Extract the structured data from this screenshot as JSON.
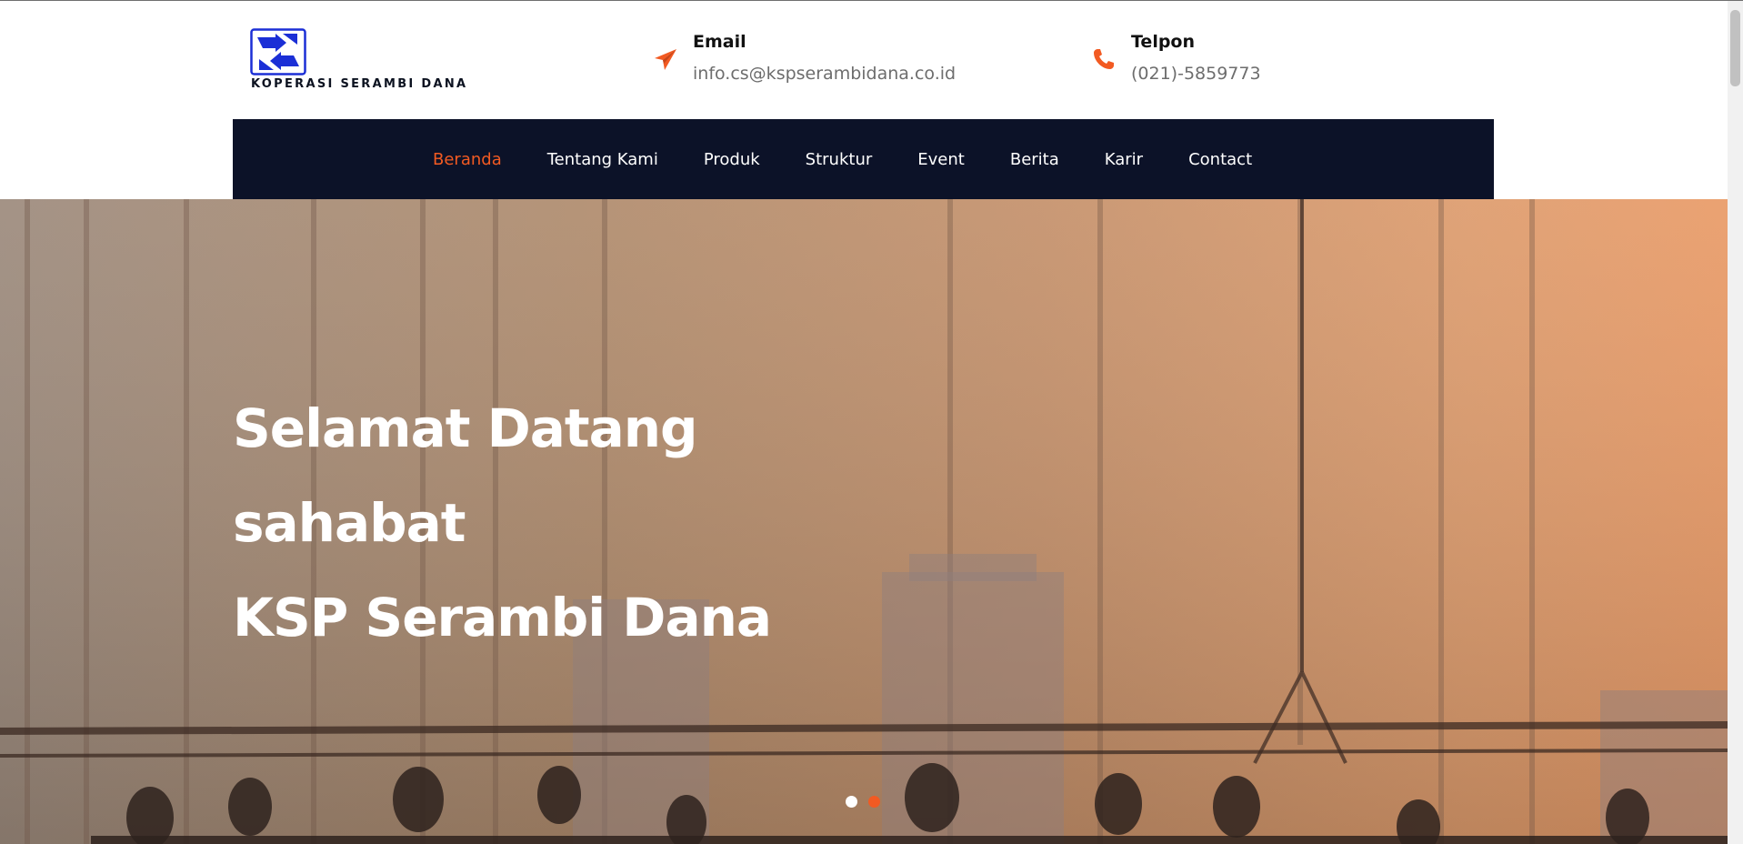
{
  "brand": {
    "name": "KOPERASI SERAMBI DANA",
    "logo_icon": "serambi-dana-logo",
    "logo_color": "#1b2fd6"
  },
  "contact": {
    "email": {
      "title": "Email",
      "value": "info.cs@kspserambidana.co.id",
      "icon": "paper-plane-icon"
    },
    "phone": {
      "title": "Telpon",
      "value": "(021)-5859773",
      "icon": "phone-icon"
    }
  },
  "nav": {
    "items": [
      {
        "label": "Beranda",
        "active": true
      },
      {
        "label": "Tentang Kami"
      },
      {
        "label": "Produk"
      },
      {
        "label": "Struktur"
      },
      {
        "label": "Event"
      },
      {
        "label": "Berita"
      },
      {
        "label": "Karir"
      },
      {
        "label": "Contact"
      }
    ]
  },
  "hero": {
    "line1": "Selamat Datang",
    "line2": "sahabat",
    "line3": "KSP Serambi Dana",
    "slides": 2,
    "active_slide": 2
  },
  "colors": {
    "accent": "#f25a22",
    "nav_bg": "#0c1228",
    "dot_inactive": "#ffffff",
    "dot_active": "#f25a22"
  }
}
